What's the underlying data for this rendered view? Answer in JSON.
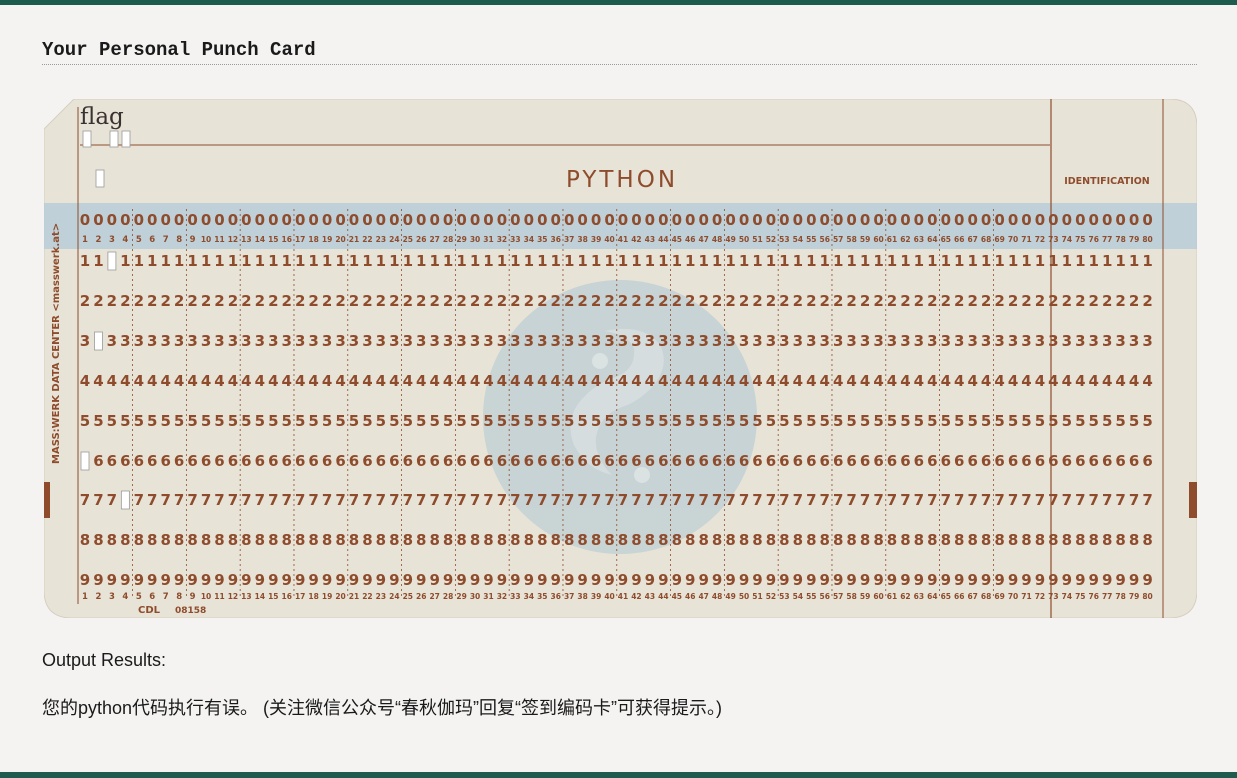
{
  "page": {
    "title": "Your Personal Punch Card",
    "output_label": "Output Results:",
    "output_message": "您的python代码执行有误。 (关注微信公众号“春秋伽玛”回复“签到编码卡”可获得提示。)"
  },
  "card": {
    "handwritten_label": "flag",
    "language": "PYTHON",
    "identification_label": "IDENTIFICATION",
    "side_text": "MASS:WERK DATA CENTER <masswerk.at>",
    "footer_code": "CDL",
    "footer_number": "08158",
    "columns": 80,
    "rows": [
      "0",
      "1",
      "2",
      "3",
      "4",
      "5",
      "6",
      "7",
      "8",
      "9"
    ],
    "punches": [
      {
        "row": "1",
        "column": 3
      },
      {
        "row": "3",
        "column": 2
      },
      {
        "row": "6",
        "column": 1
      },
      {
        "row": "7",
        "column": 4
      }
    ],
    "colors": {
      "card": "#e8e3d7",
      "ink": "#8e4c2c",
      "band": "#b7cdd8",
      "logo": "#c3d1d5"
    }
  }
}
